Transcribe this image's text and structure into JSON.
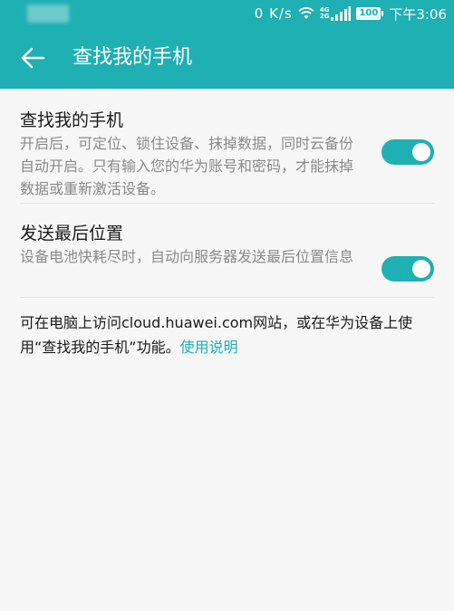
{
  "status_bar": {
    "net_speed": "0 K/s",
    "net_type_top": "4G",
    "net_type_bottom": "2G",
    "battery": "100",
    "time": "下午3:06"
  },
  "app_bar": {
    "title": "查找我的手机"
  },
  "settings": [
    {
      "title": "查找我的手机",
      "description": "开启后，可定位、锁住设备、抹掉数据，同时云备份自动开启。只有输入您的华为账号和密码，才能抹掉数据或重新激活设备。",
      "enabled": true
    },
    {
      "title": "发送最后位置",
      "description": "设备电池快耗尽时，自动向服务器发送最后位置信息",
      "enabled": true
    }
  ],
  "footer": {
    "text": "可在电脑上访问cloud.huawei.com网站，或在华为设备上使用“查找我的手机”功能。",
    "link_label": "使用说明"
  },
  "colors": {
    "accent": "#1fb0b3",
    "background": "#f7f7f7",
    "description_text": "#8a8a8a"
  }
}
